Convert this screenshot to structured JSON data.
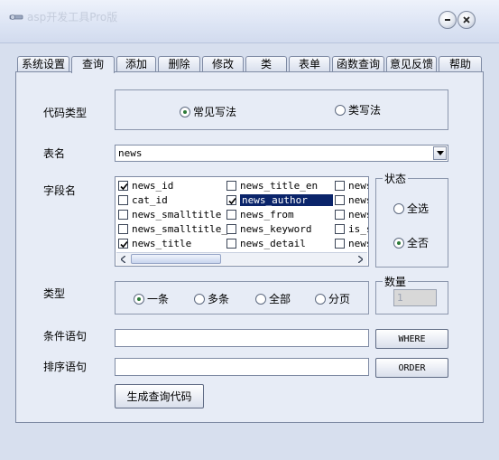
{
  "window": {
    "title": "asp开发工具Pro版",
    "icon": "tools-icon",
    "minimize_icon": "minimize-icon",
    "close_icon": "close-icon"
  },
  "tabs": [
    {
      "label": "系统设置",
      "active": false
    },
    {
      "label": "查询",
      "active": true
    },
    {
      "label": "添加",
      "active": false
    },
    {
      "label": "删除",
      "active": false
    },
    {
      "label": "修改",
      "active": false
    },
    {
      "label": "类",
      "active": false
    },
    {
      "label": "表单",
      "active": false
    },
    {
      "label": "函数查询",
      "active": false
    },
    {
      "label": "意见反馈",
      "active": false
    },
    {
      "label": "帮助",
      "active": false
    }
  ],
  "code_type": {
    "label": "代码类型",
    "options": [
      {
        "label": "常见写法",
        "selected": true
      },
      {
        "label": "类写法",
        "selected": false
      }
    ]
  },
  "table_name": {
    "label": "表名",
    "value": "news"
  },
  "fields": {
    "label": "字段名",
    "columns": [
      [
        {
          "name": "news_id",
          "checked": true
        },
        {
          "name": "cat_id",
          "checked": false
        },
        {
          "name": "news_smalltitle",
          "checked": false
        },
        {
          "name": "news_smalltitle_e",
          "checked": false
        },
        {
          "name": "news_title",
          "checked": true
        }
      ],
      [
        {
          "name": "news_title_en",
          "checked": false
        },
        {
          "name": "news_author",
          "checked": true,
          "highlighted": true
        },
        {
          "name": "news_from",
          "checked": false
        },
        {
          "name": "news_keyword",
          "checked": false
        },
        {
          "name": "news_detail",
          "checked": false
        }
      ],
      [
        {
          "name": "news",
          "checked": false
        },
        {
          "name": "news",
          "checked": false
        },
        {
          "name": "news",
          "checked": false
        },
        {
          "name": "is_s",
          "checked": false
        },
        {
          "name": "news",
          "checked": false
        }
      ]
    ]
  },
  "status": {
    "label": "状态",
    "options": [
      {
        "label": "全选",
        "selected": false
      },
      {
        "label": "全否",
        "selected": true
      }
    ]
  },
  "type": {
    "label": "类型",
    "options": [
      {
        "label": "一条",
        "selected": true
      },
      {
        "label": "多条",
        "selected": false
      },
      {
        "label": "全部",
        "selected": false
      },
      {
        "label": "分页",
        "selected": false
      }
    ]
  },
  "quantity": {
    "label": "数量",
    "value": "1"
  },
  "condition": {
    "label": "条件语句",
    "value": "",
    "button": "WHERE"
  },
  "order": {
    "label": "排序语句",
    "value": "",
    "button": "ORDER"
  },
  "generate_button": "生成查询代码",
  "colors": {
    "background": "#d7dfee",
    "panel": "#e7ecf6",
    "selection": "#0a246a"
  }
}
